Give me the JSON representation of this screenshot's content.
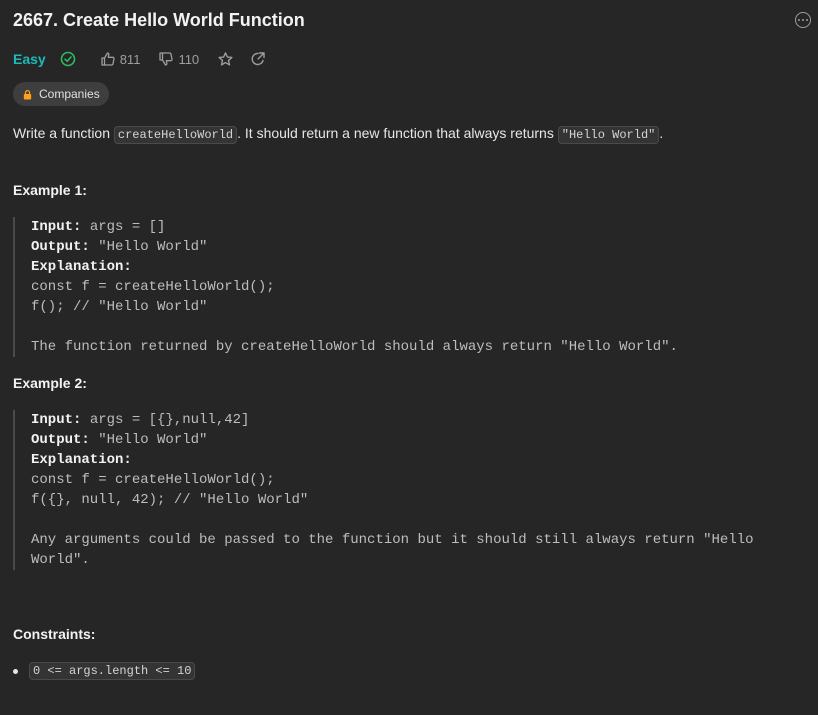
{
  "problem": {
    "title": "2667. Create Hello World Function",
    "difficulty": "Easy",
    "likes": "811",
    "dislikes": "110",
    "companies_label": "Companies"
  },
  "description": {
    "t1": "Write a function ",
    "code1": "createHelloWorld",
    "t2": ". It should return a new function that always returns ",
    "code2": "\"Hello World\"",
    "t3": "."
  },
  "examples": [
    {
      "heading": "Example 1:",
      "input_label": "Input:",
      "input": " args = []",
      "output_label": "Output:",
      "output": " \"Hello World\"",
      "explanation_label": "Explanation:",
      "code_lines": [
        "const f = createHelloWorld();",
        "f(); // \"Hello World\""
      ],
      "note": "The function returned by createHelloWorld should always return \"Hello World\"."
    },
    {
      "heading": "Example 2:",
      "input_label": "Input:",
      "input": " args = [{},null,42]",
      "output_label": "Output:",
      "output": " \"Hello World\"",
      "explanation_label": "Explanation:",
      "code_lines": [
        "const f = createHelloWorld();",
        "f({}, null, 42); // \"Hello World\""
      ],
      "note": "Any arguments could be passed to the function but it should still always return \"Hello World\"."
    }
  ],
  "constraints": {
    "heading": "Constraints:",
    "items": [
      "0 <= args.length <= 10"
    ]
  },
  "icons": {
    "solved": "check-circle-icon",
    "like": "thumbs-up-icon",
    "dislike": "thumbs-down-icon",
    "favorite": "star-icon",
    "share": "share-icon",
    "lock": "lock-icon",
    "more": "more-icon"
  },
  "colors": {
    "background": "#262626",
    "easy": "#1cbaba",
    "solved": "#2cbb5d",
    "lock": "#ffa116"
  }
}
